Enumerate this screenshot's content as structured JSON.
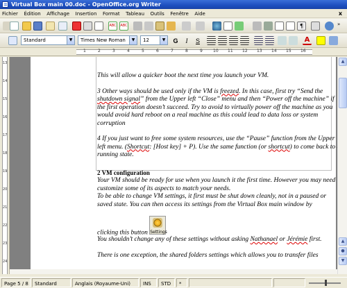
{
  "window": {
    "title": "Virtual Box main 00.doc - OpenOffice.org Writer"
  },
  "menu": {
    "items": [
      "Fichier",
      "Édition",
      "Affichage",
      "Insertion",
      "Format",
      "Tableau",
      "Outils",
      "Fenêtre",
      "Aide"
    ],
    "close_doc": "x"
  },
  "toolbar2": {
    "style_value": "Standard",
    "font_value": "Times New Roman",
    "size_value": "12",
    "bold": "G",
    "italic": "I",
    "underline": "S"
  },
  "ruler": {
    "numbers": [
      "1",
      "2",
      "3",
      "4",
      "5",
      "6",
      "7",
      "8",
      "9",
      "10",
      "11",
      "12",
      "13",
      "14",
      "15",
      "16"
    ]
  },
  "vruler": {
    "numbers": [
      "13",
      "14",
      "15",
      "16",
      "17",
      "18",
      "19",
      "20",
      "21",
      "22",
      "23",
      "24"
    ]
  },
  "document": {
    "p1": "This will allow a quicker boot the next time you launch your VM.",
    "p2_a": "3 Other ways should be used only if the VM is ",
    "p2_err1": "freezed",
    "p2_b": ". In this case, first try “Send the ",
    "p2_err2": "shutdown signal",
    "p2_c": "” from the Upper left “Close” menu and then “Power off the machine” if the first operation doesn’t succeed. Try to avoid to virtually power off the machine as you would avoid hard reboot on a real machine as this could lead to data loss or system corruption",
    "p3_a": "4 If you just want to free some system resources, use the “Pause” function from the Upper left menu. (",
    "p3_err1": "Shortcut",
    "p3_b": ": [Host key] + P). Use the same function (or ",
    "p3_err2": "shortcut",
    "p3_c": ") to come back to a running state.",
    "heading": "2 VM configuration",
    "p4": "Your VM should be ready for use when you launch it the first time. However you may need to customize some of its aspects to match your needs.",
    "p5": "To be able to change VM settings, it first must be shut down cleanly, not in a paused or saved state. You can then access its settings from the Virtual Box main window by",
    "p6_a": "clicking this button",
    "settings_label": "Settings",
    "p7_a": "You shouldn’t change any of these settings without asking ",
    "p7_err1": "Nathanael",
    "p7_b": " or ",
    "p7_err2": "Jérémie",
    "p7_c": " first.",
    "p8": "There is one exception, the shared folders settings which allows you to transfer files"
  },
  "status": {
    "page": "Page 5 / 8",
    "style": "Standard",
    "language": "Anglais (Royaume-Uni)",
    "ins": "INS",
    "std": "STD",
    "star": "*"
  },
  "colors": {
    "titlebar": "#1d4fbf",
    "spell_error": "#dd0000",
    "doc_bg": "#808080"
  }
}
